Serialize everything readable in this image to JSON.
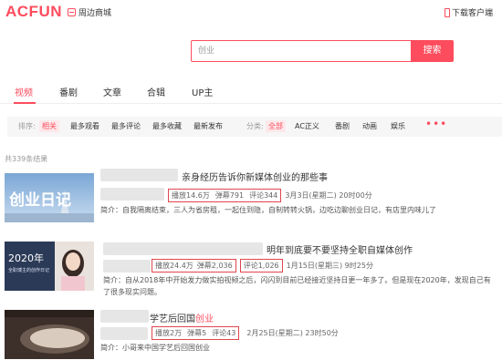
{
  "header": {
    "logo": "ACFUN",
    "mall": "周边商城",
    "client": "下载客户端"
  },
  "search": {
    "value": "创业",
    "button": "搜索"
  },
  "tabs": [
    "视频",
    "番剧",
    "文章",
    "合辑",
    "UP主"
  ],
  "filters": {
    "sort_label": "排序:",
    "sort": [
      "相关",
      "最多观看",
      "最多评论",
      "最多收藏",
      "最新发布"
    ],
    "cat_label": "分类:",
    "cats": [
      "全部",
      "AC正义",
      "番剧",
      "动画",
      "娱乐"
    ],
    "more": "•••"
  },
  "result_count": "共339条结果",
  "items": [
    {
      "title": "亲身经历告诉你新媒体创业的那些事",
      "thumb_text": "创业日记",
      "play": "播放14.6万",
      "danmu": "弹幕791",
      "comment": "评论344",
      "date": "3月3日(星期二) 20时00分",
      "desc_label": "简介：",
      "desc": "自我隔离结束，三人为省房租，一起住到隐，自制转转火锅，边吃边聊创业日记，有店里内味儿了"
    },
    {
      "title": "明年到底要不要坚持全职自媒体创作",
      "thumb_text": "2020年",
      "thumb_sub": "全职博主的创作日记",
      "play": "播放24.4万",
      "danmu": "弹幕2,036",
      "comment": "评论1,026",
      "date": "1月15日(星期三) 9时25分",
      "desc_label": "简介：",
      "desc": "自从2018年中开始发力做实拍视频之后，闪闪到目前已经接近坚持日更一年多了。但是现在2020年，发现自己有",
      "desc2": "了很多现实问题。"
    },
    {
      "title_pre": "学艺后回国",
      "title_hl": "创业",
      "play": "播放2万",
      "danmu": "弹幕5",
      "comment": "评论43",
      "date": "2月25日(星期二) 23时50分",
      "desc_label": "简介：",
      "desc": "小哥来中国学艺后回国创业"
    }
  ],
  "colors": {
    "accent": "#fd4c5d"
  }
}
